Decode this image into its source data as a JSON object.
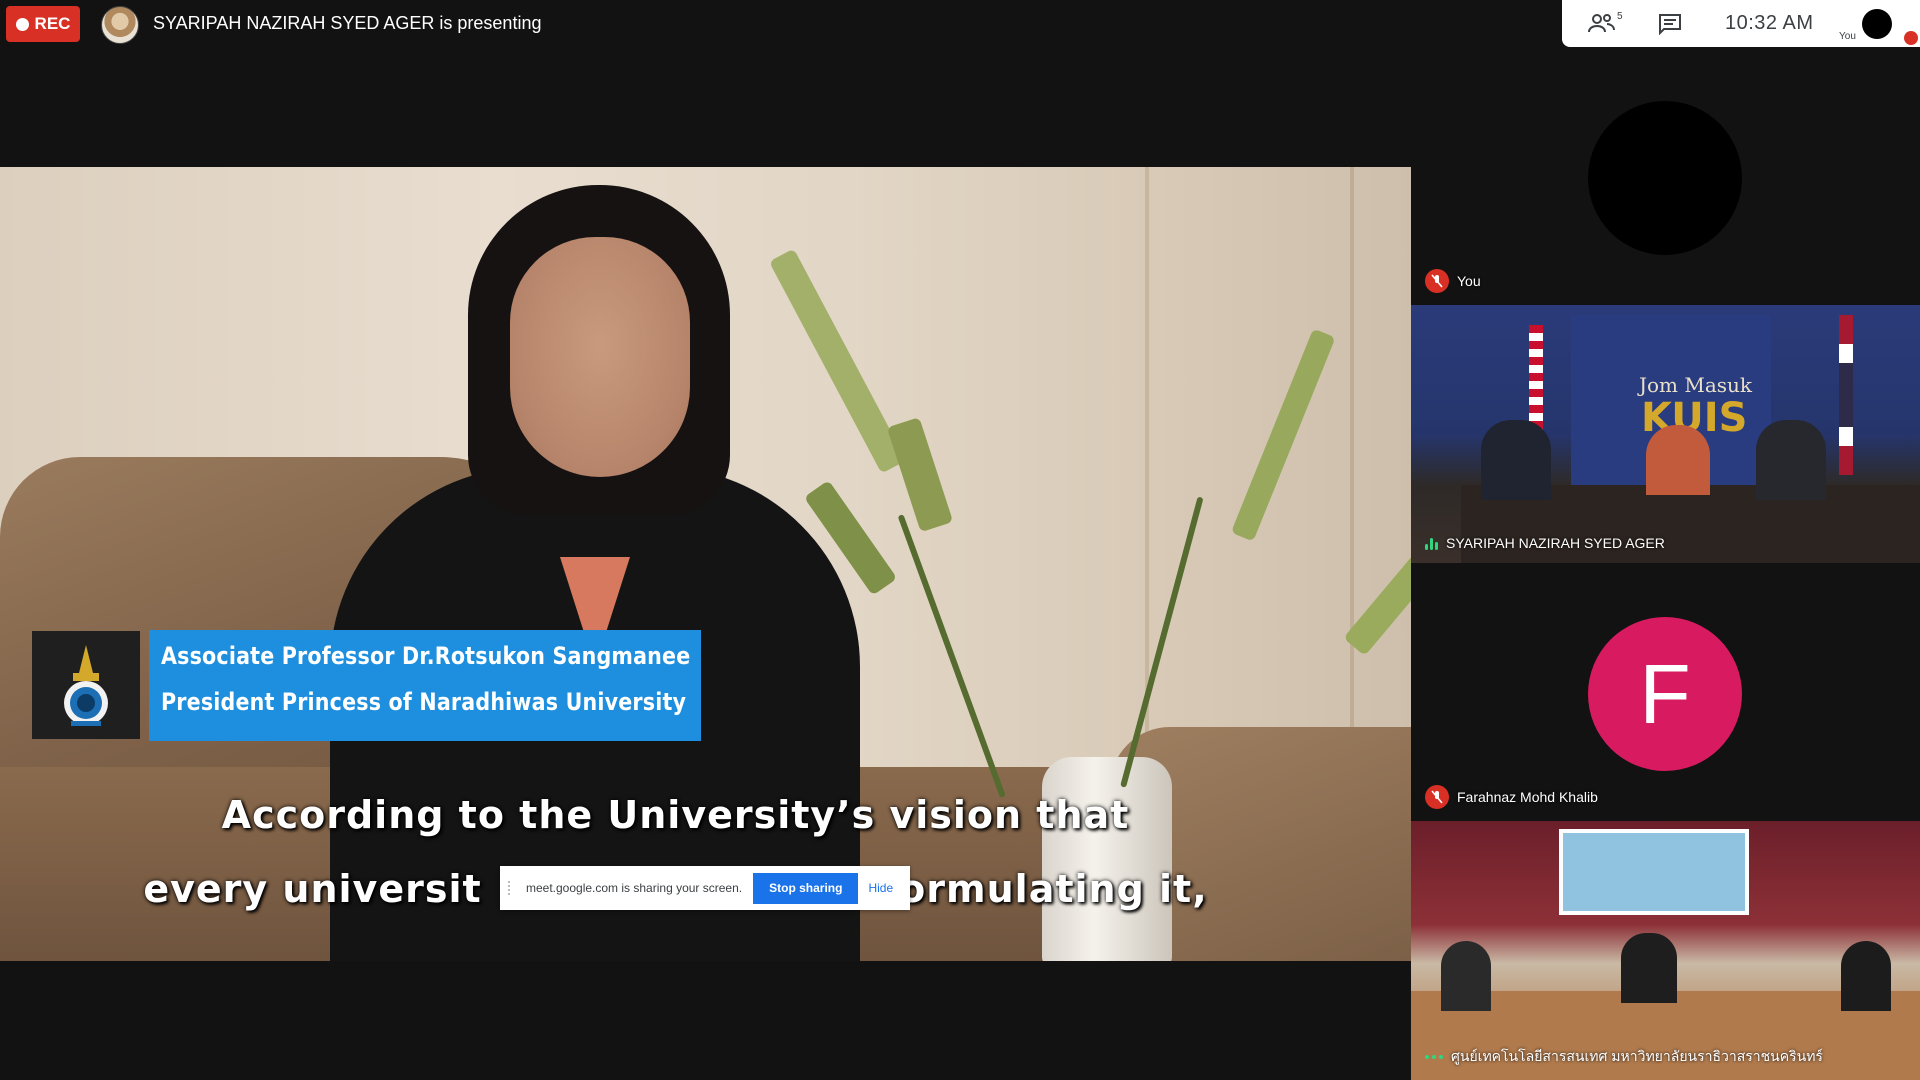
{
  "topbar": {
    "rec_label": "REC",
    "presenting_text": "SYARIPAH NAZIRAH SYED AGER is presenting"
  },
  "status_panel": {
    "people_count": "5",
    "clock": "10:32  AM",
    "self_label": "You"
  },
  "main_video": {
    "caption_name": "Associate Professor Dr.Rotsukon Sangmanee",
    "caption_title": "President Princess of Naradhiwas University",
    "subtitle_line1": "According to the University’s vision that",
    "subtitle_line2_left": "every universit",
    "subtitle_line2_right": "formulating it,"
  },
  "share_bar": {
    "message": "meet.google.com is sharing your screen.",
    "stop_label": "Stop sharing",
    "hide_label": "Hide"
  },
  "tiles": [
    {
      "name": "You",
      "state": "muted"
    },
    {
      "name": "SYARIPAH NAZIRAH SYED AGER",
      "state": "speaking",
      "scene_text_1": "Jom Masuk",
      "scene_text_2": "KUIS"
    },
    {
      "name": "Farahnaz Mohd Khalib",
      "state": "muted",
      "initial": "F"
    },
    {
      "name": "ศูนย์เทคโนโลยีสารสนเทศ มหาวิทยาลัยนราธิวาสราชนครินทร์",
      "state": "active"
    }
  ],
  "colors": {
    "rec_red": "#d93025",
    "meet_blue": "#1a73e8",
    "caption_blue": "#1e8fde",
    "avatar_pink": "#d81b60",
    "speaking_green": "#2fd67e"
  }
}
